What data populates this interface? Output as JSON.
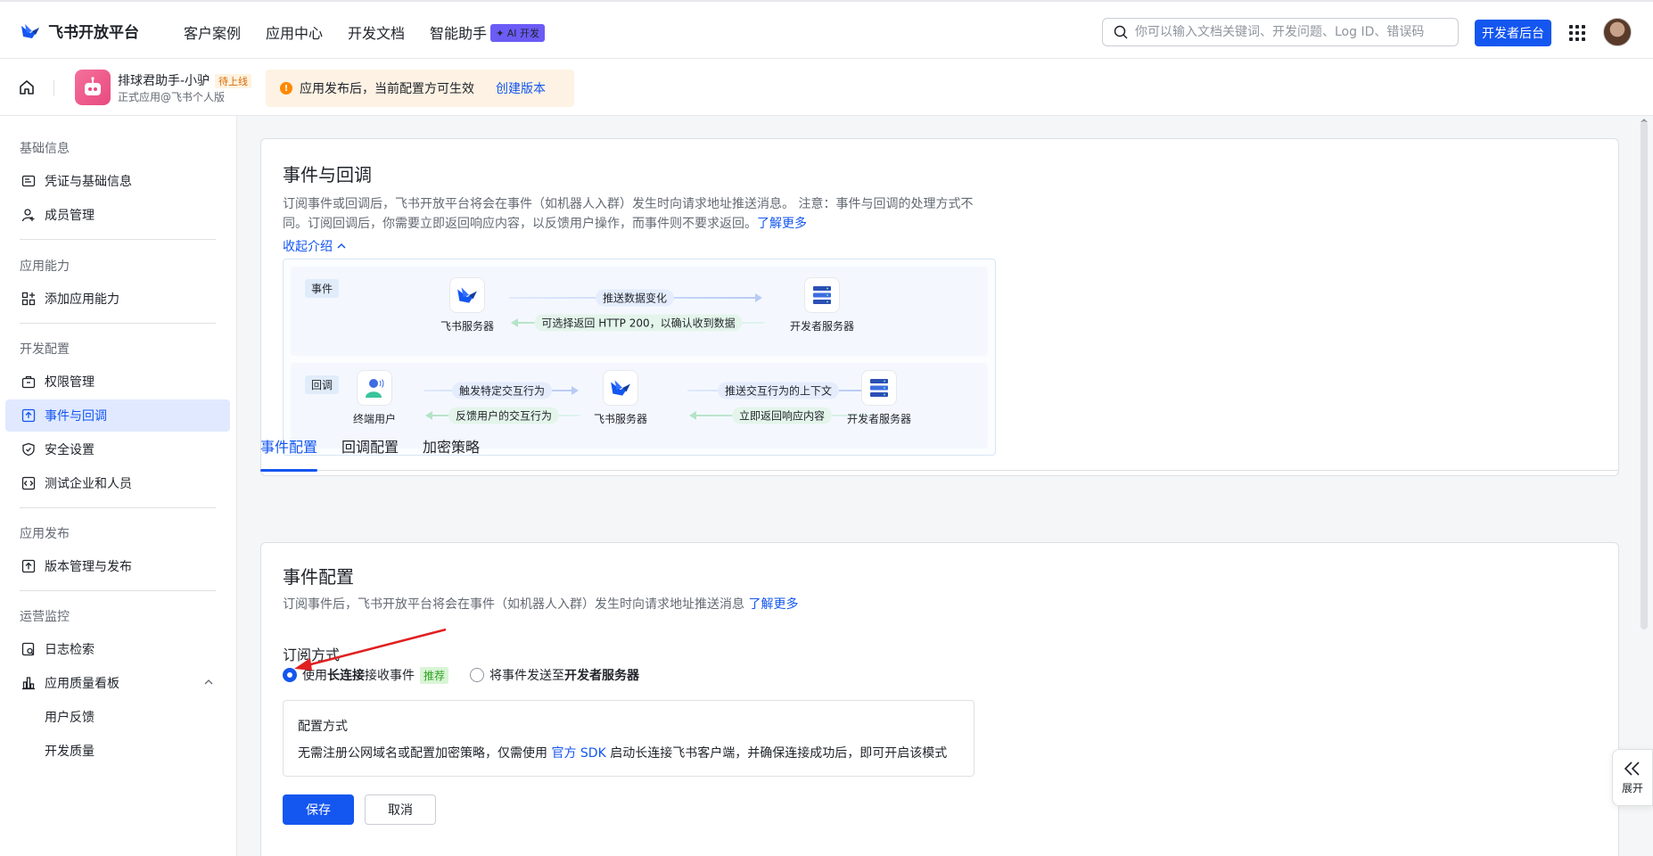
{
  "header": {
    "logo_text": "飞书开放平台",
    "nav": [
      "客户案例",
      "应用中心",
      "开发文档",
      "智能助手"
    ],
    "ai_badge": "✦ AI 开发",
    "search_placeholder": "你可以输入文档关键词、开发问题、Log ID、错误码",
    "dev_console_label": "开发者后台"
  },
  "app_bar": {
    "app_name": "排球君助手-小驴",
    "status": "待上线",
    "app_type": "正式应用@飞书个人版",
    "notice_text": "应用发布后，当前配置方可生效",
    "notice_link": "创建版本"
  },
  "sidebar": {
    "sections": [
      {
        "title": "基础信息",
        "items": [
          "凭证与基础信息",
          "成员管理"
        ]
      },
      {
        "title": "应用能力",
        "items": [
          "添加应用能力"
        ]
      },
      {
        "title": "开发配置",
        "items": [
          "权限管理",
          "事件与回调",
          "安全设置",
          "测试企业和人员"
        ]
      },
      {
        "title": "应用发布",
        "items": [
          "版本管理与发布"
        ]
      },
      {
        "title": "运营监控",
        "items": [
          "日志检索",
          "应用质量看板",
          "用户反馈",
          "开发质量"
        ]
      }
    ],
    "active_item": "事件与回调"
  },
  "intro": {
    "title": "事件与回调",
    "desc": "订阅事件或回调后，飞书开放平台将会在事件（如机器人入群）发生时向请求地址推送消息。 注意：事件与回调的处理方式不同。订阅回调后，你需要立即返回响应内容，以反馈用户操作，而事件则不要求返回。",
    "learn_more": "了解更多",
    "collapse_label": "收起介绍",
    "diagram": {
      "event_tag": "事件",
      "callback_tag": "回调",
      "feishu_server": "飞书服务器",
      "dev_server": "开发者服务器",
      "end_user": "终端用户",
      "push_data": "推送数据变化",
      "return_200": "可选择返回 HTTP 200，以确认收到数据",
      "trigger": "触发特定交互行为",
      "feedback": "反馈用户的交互行为",
      "push_context": "推送交互行为的上下文",
      "return_now": "立即返回响应内容"
    }
  },
  "tabs": [
    "事件配置",
    "回调配置",
    "加密策略"
  ],
  "event_config": {
    "title": "事件配置",
    "desc": "订阅事件后，飞书开放平台将会在事件（如机器人入群）发生时向请求地址推送消息",
    "learn_more": "了解更多",
    "subscribe_label": "订阅方式",
    "option1_pre": "使用 ",
    "option1_bold": "长连接",
    "option1_post": " 接收事件",
    "recommended": "推荐",
    "option2_pre": "将事件发送至 ",
    "option2_bold": "开发者服务器",
    "cfg_title": "配置方式",
    "cfg_desc_pre": "无需注册公网域名或配置加密策略，仅需使用 ",
    "cfg_desc_link": "官方 SDK",
    "cfg_desc_post": " 启动长连接飞书客户端，并确保连接成功后，即可开启该模式",
    "save": "保存",
    "cancel": "取消"
  },
  "expand_label": "展开",
  "colors": {
    "primary": "#1456f0",
    "active_bg": "#e0e9ff",
    "annotation_arrow": "#e02020"
  }
}
